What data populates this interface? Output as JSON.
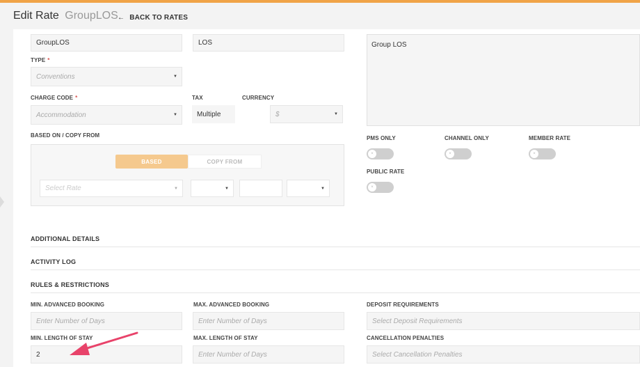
{
  "header": {
    "title": "Edit Rate",
    "rate_name": "GroupLOS",
    "back_label": "BACK TO RATES",
    "back_icon": "arrow-left-icon",
    "accent_color": "#f0a347"
  },
  "form": {
    "name_value": "GroupLOS",
    "code_value": "LOS",
    "description_value": "Group LOS",
    "type_label": "TYPE",
    "type_placeholder": "Conventions",
    "charge_code_label": "CHARGE CODE",
    "charge_code_placeholder": "Accommodation",
    "tax_label": "TAX",
    "tax_value": "Multiple",
    "currency_label": "CURRENCY",
    "currency_placeholder": "$",
    "required_mark": "*",
    "based_on_label": "BASED ON / COPY FROM",
    "based_tab": "BASED",
    "copy_from_tab": "COPY FROM",
    "select_rate_placeholder": "Select Rate"
  },
  "toggles": {
    "pms_only": "PMS ONLY",
    "channel_only": "CHANNEL ONLY",
    "member_rate": "MEMBER RATE",
    "public_rate": "PUBLIC RATE",
    "knob_glyph": "×"
  },
  "sections": {
    "additional_details": "ADDITIONAL DETAILS",
    "activity_log": "ACTIVITY LOG",
    "rules_restrictions": "RULES & RESTRICTIONS"
  },
  "rules": {
    "min_adv_label": "MIN. ADVANCED BOOKING",
    "min_adv_placeholder": "Enter Number of Days",
    "max_adv_label": "MAX. ADVANCED BOOKING",
    "max_adv_placeholder": "Enter Number of Days",
    "deposit_label": "DEPOSIT REQUIREMENTS",
    "deposit_placeholder": "Select Deposit Requirements",
    "min_los_label": "MIN. LENGTH OF STAY",
    "min_los_value": "2",
    "max_los_label": "MAX. LENGTH OF STAY",
    "max_los_placeholder": "Enter Number of Days",
    "cancel_label": "CANCELLATION PENALTIES",
    "cancel_placeholder": "Select Cancellation Penalties"
  },
  "annotation_color": "#e8436a"
}
